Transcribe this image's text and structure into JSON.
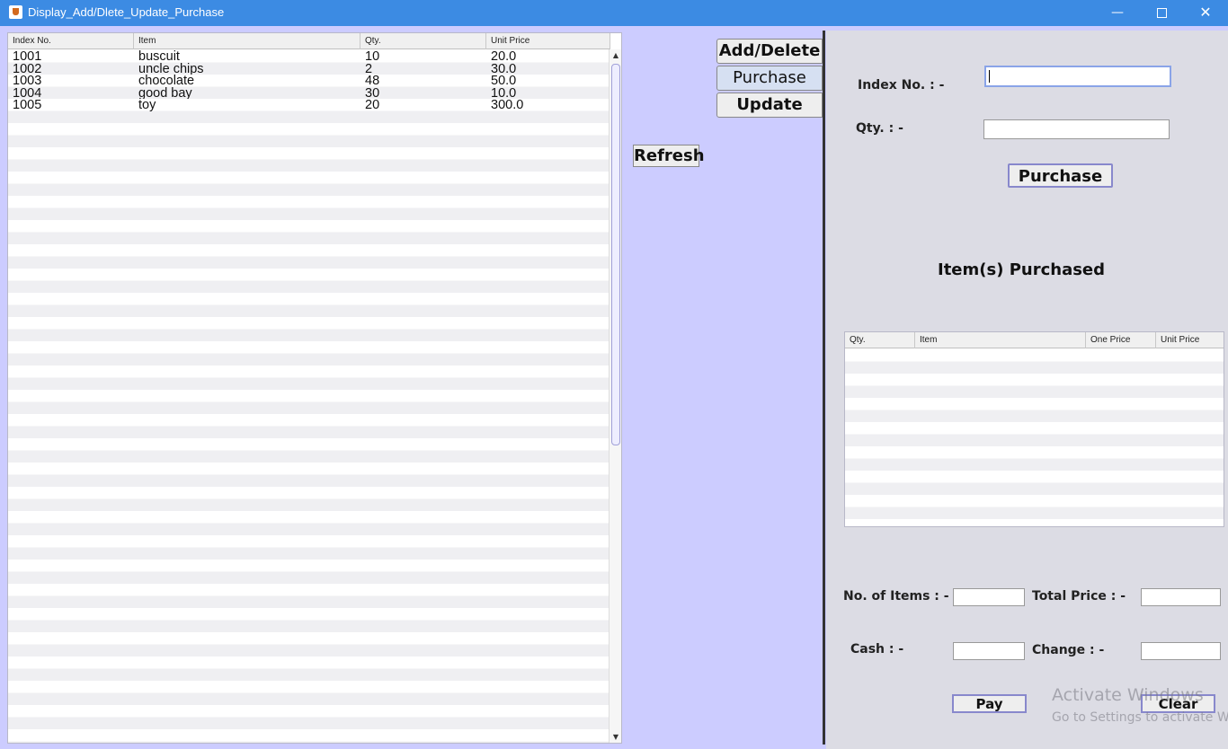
{
  "window": {
    "title": "Display_Add/Dlete_Update_Purchase",
    "minimize": "—",
    "close": "✕"
  },
  "inventory_table": {
    "headers": [
      "Index No.",
      "Item",
      "Qty.",
      "Unit Price"
    ],
    "rows": [
      [
        "1001",
        "buscuit",
        "10",
        "20.0"
      ],
      [
        "1002",
        "uncle chips",
        "2",
        "30.0"
      ],
      [
        "1003",
        "chocolate",
        "48",
        "50.0"
      ],
      [
        "1004",
        "good bay",
        "30",
        "10.0"
      ],
      [
        "1005",
        "toy",
        "20",
        "300.0"
      ]
    ]
  },
  "buttons": {
    "refresh": "Refresh",
    "tab_add_delete": "Add/Delete",
    "tab_purchase": "Purchase",
    "tab_update": "Update",
    "purchase": "Purchase",
    "pay": "Pay",
    "clear": "Clear"
  },
  "purchase_form": {
    "index_label": "Index No. : -",
    "qty_label": "Qty. : -",
    "index_value": "",
    "qty_value": ""
  },
  "purchased_section": {
    "title": "Item(s) Purchased",
    "headers": [
      "Qty.",
      "Item",
      "One Price",
      "Unit Price"
    ]
  },
  "totals": {
    "no_items_label": "No. of Items : -",
    "total_price_label": "Total Price : -",
    "cash_label": "Cash : -",
    "change_label": "Change : -"
  },
  "watermark": {
    "line1": "Activate Windows",
    "line2": "Go to Settings to activate Windows."
  }
}
